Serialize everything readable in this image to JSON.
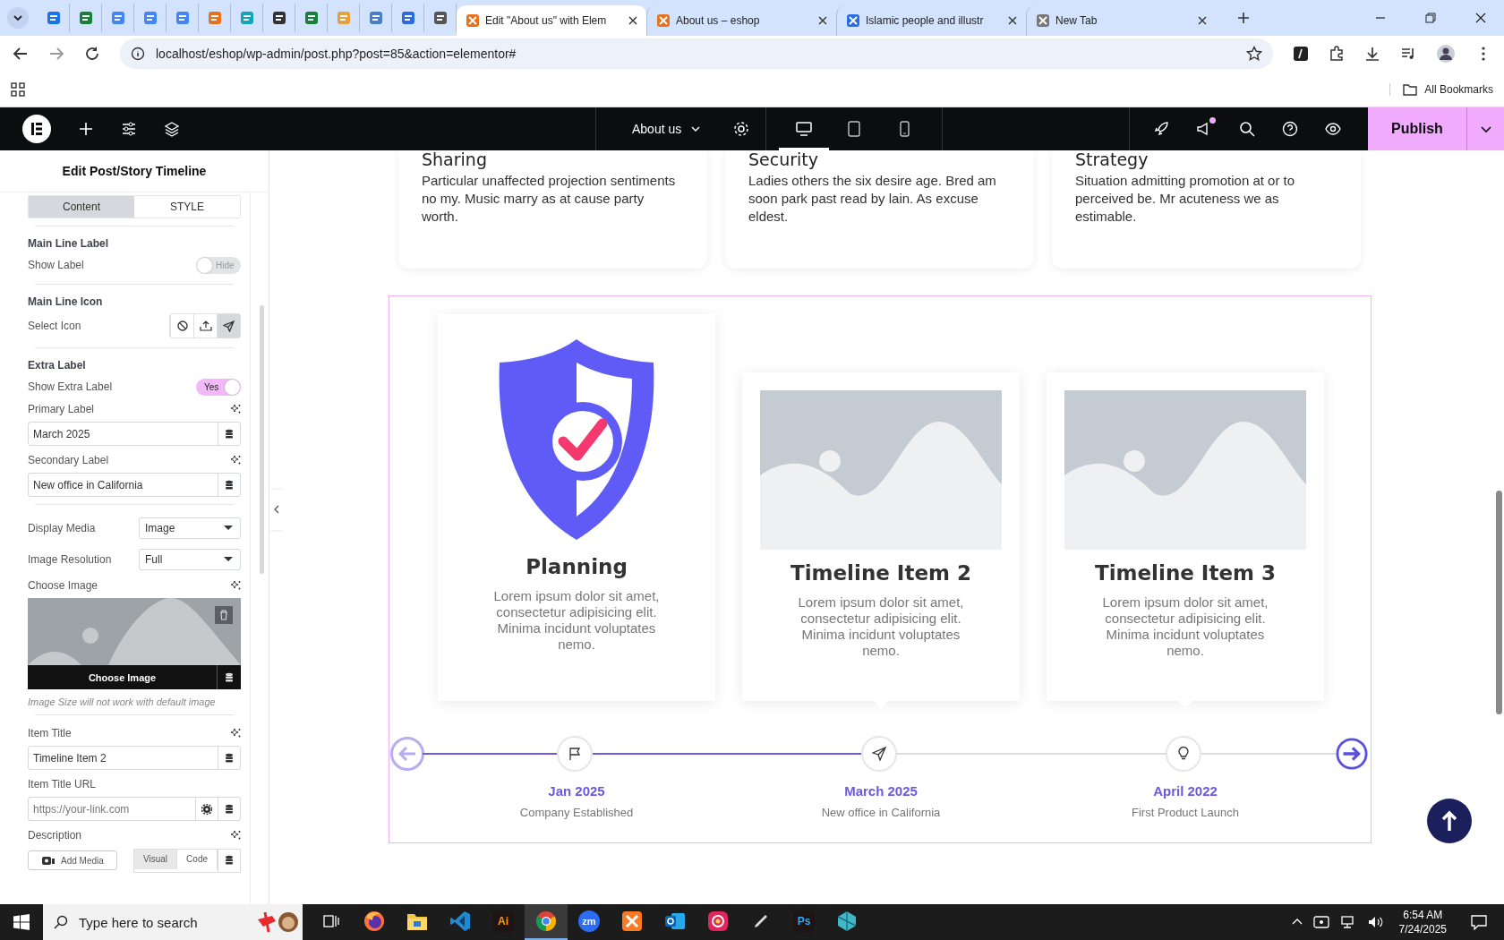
{
  "browser": {
    "tabs": [
      {
        "title": "Edit \"About us\" with Elem",
        "selected": true
      },
      {
        "title": "About us – eshop",
        "selected": false
      },
      {
        "title": "Islamic people and illustr",
        "selected": false
      },
      {
        "title": "New Tab",
        "selected": false
      }
    ],
    "url": "localhost/eshop/wp-admin/post.php?post=85&action=elementor#",
    "bookmarks": "All Bookmarks"
  },
  "editor_bar": {
    "page": "About us",
    "devices": [
      {
        "kind": "desktop",
        "selected": true
      },
      {
        "kind": "tablet",
        "selected": false
      },
      {
        "kind": "mobile",
        "selected": false
      }
    ],
    "notification": true,
    "publish": "Publish"
  },
  "panel": {
    "title": "Edit Post/Story Timeline",
    "tabs": [
      {
        "label": "Content",
        "selected": true
      },
      {
        "label": "STYLE",
        "selected": false
      }
    ],
    "controls": [
      {
        "kind": "divider"
      },
      {
        "kind": "heading",
        "label": "Main Line Label"
      },
      {
        "kind": "switch",
        "label": "Show Label",
        "on": false,
        "text": "Hide"
      },
      {
        "kind": "divider"
      },
      {
        "kind": "heading",
        "label": "Main Line Icon"
      },
      {
        "kind": "icons",
        "label": "Select Icon",
        "options": [
          {
            "kind": "none",
            "selected": false
          },
          {
            "kind": "upload",
            "selected": false
          },
          {
            "kind": "plane",
            "selected": true
          }
        ]
      },
      {
        "kind": "divider"
      },
      {
        "kind": "heading",
        "label": "Extra Label"
      },
      {
        "kind": "switch",
        "label": "Show Extra Label",
        "on": true,
        "text": "Yes"
      },
      {
        "kind": "label",
        "label": "Primary Label",
        "ai": true
      },
      {
        "kind": "input",
        "value": "March 2025"
      },
      {
        "kind": "label",
        "label": "Secondary Label",
        "ai": true
      },
      {
        "kind": "input",
        "value": "New office in California"
      },
      {
        "kind": "divider"
      },
      {
        "kind": "select",
        "label": "Display Media",
        "value": "Image"
      },
      {
        "kind": "select",
        "label": "Image Resolution",
        "value": "Full"
      },
      {
        "kind": "label",
        "label": "Choose Image",
        "ai": true
      },
      {
        "kind": "media",
        "button": "Choose Image"
      },
      {
        "kind": "note",
        "text": "Image Size will not work with default image"
      },
      {
        "kind": "divider"
      },
      {
        "kind": "label",
        "label": "Item Title",
        "ai": true
      },
      {
        "kind": "input",
        "value": "Timeline Item 2"
      },
      {
        "kind": "label",
        "label": "Item Title URL",
        "ai": false
      },
      {
        "kind": "url",
        "placeholder": "https://your-link.com"
      },
      {
        "kind": "label",
        "label": "Description",
        "ai": true
      },
      {
        "kind": "editor",
        "button": "Add Media",
        "modes": [
          {
            "label": "Visual",
            "selected": true
          },
          {
            "label": "Code",
            "selected": false
          }
        ]
      }
    ]
  },
  "canvas": {
    "features": [
      {
        "title": "Sharing",
        "text": "Particular unaffected projection sentiments no my. Music marry as at cause party worth."
      },
      {
        "title": "Security",
        "text": "Ladies others the six desire age. Bred am soon park past read by lain. As excuse eldest."
      },
      {
        "title": "Strategy",
        "text": "Situation admitting promotion at or to perceived be. Mr acuteness we as estimable."
      }
    ],
    "timeline": {
      "prev_disabled": true,
      "next_disabled": false,
      "items": [
        {
          "kind": "illustration",
          "title": "Planning",
          "text": "Lorem ipsum dolor sit amet, consectetur adipisicing elit. Minima incidunt voluptates nemo.",
          "date": "Jan 2025",
          "caption": "Company Established",
          "reached": true
        },
        {
          "kind": "image",
          "title": "Timeline Item 2",
          "text": "Lorem ipsum dolor sit amet, consectetur adipisicing elit. Minima incidunt voluptates nemo.",
          "date": "March 2025",
          "caption": "New office in California",
          "reached": true
        },
        {
          "kind": "image",
          "title": "Timeline Item 3",
          "text": "Lorem ipsum dolor sit amet, consectetur adipisicing elit. Minima incidunt voluptates nemo.",
          "date": "April 2022",
          "caption": "First Product Launch",
          "reached": false
        }
      ]
    }
  },
  "taskbar": {
    "search": {
      "placeholder": "Type here to search"
    },
    "apps": [
      {
        "kind": "taskview",
        "selected": false
      },
      {
        "kind": "firefox",
        "selected": false
      },
      {
        "kind": "folder",
        "selected": false
      },
      {
        "kind": "vscode",
        "selected": false
      },
      {
        "kind": "tile",
        "label": "Ai",
        "color": "#ff9a00",
        "selected": false
      },
      {
        "kind": "chrome",
        "selected": true
      },
      {
        "kind": "round",
        "label": "zm",
        "color": "#2d6cf5",
        "selected": false
      },
      {
        "kind": "xampp",
        "selected": false
      },
      {
        "kind": "outlook",
        "selected": false
      },
      {
        "kind": "cloud",
        "selected": false
      },
      {
        "kind": "pen",
        "selected": false
      },
      {
        "kind": "tile",
        "label": "Ps",
        "color": "#31a8ff",
        "selected": false
      },
      {
        "kind": "gem",
        "selected": false
      }
    ],
    "time": "6:54 AM",
    "date": "7/24/2025"
  }
}
